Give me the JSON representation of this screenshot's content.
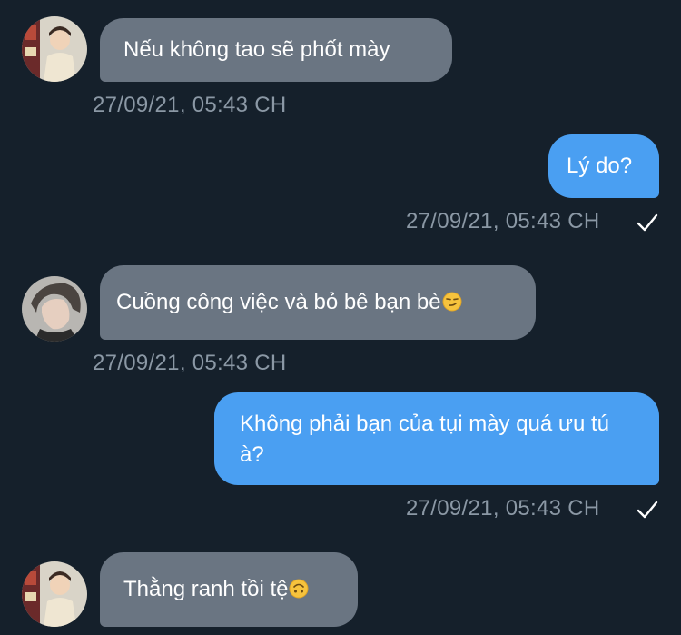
{
  "colors": {
    "background": "#15202b",
    "incoming_bubble": "#6a7582",
    "outgoing_bubble": "#4a9ff2",
    "timestamp": "#8b98a5"
  },
  "messages": [
    {
      "direction": "received",
      "text": "Nếu không tao sẽ phốt mày",
      "time": "27/09/21, 05:43 CH",
      "avatar": "avatar-icon"
    },
    {
      "direction": "sent",
      "text": "Lý do?",
      "time": "27/09/21, 05:43 CH",
      "status_icon": "checkmark-icon"
    },
    {
      "direction": "received",
      "text": "Cuồng công việc và bỏ bê bạn bè",
      "emoji": "smirk-emoji-icon",
      "time": "27/09/21, 05:43 CH",
      "avatar": "avatar-icon"
    },
    {
      "direction": "sent",
      "text": "Không phải bạn của tụi mày quá ưu tú à?",
      "time": "27/09/21, 05:43 CH",
      "status_icon": "checkmark-icon"
    },
    {
      "direction": "received",
      "text": "Thằng ranh tồi tệ",
      "emoji": "upside-down-face-emoji-icon",
      "avatar": "avatar-icon"
    }
  ]
}
